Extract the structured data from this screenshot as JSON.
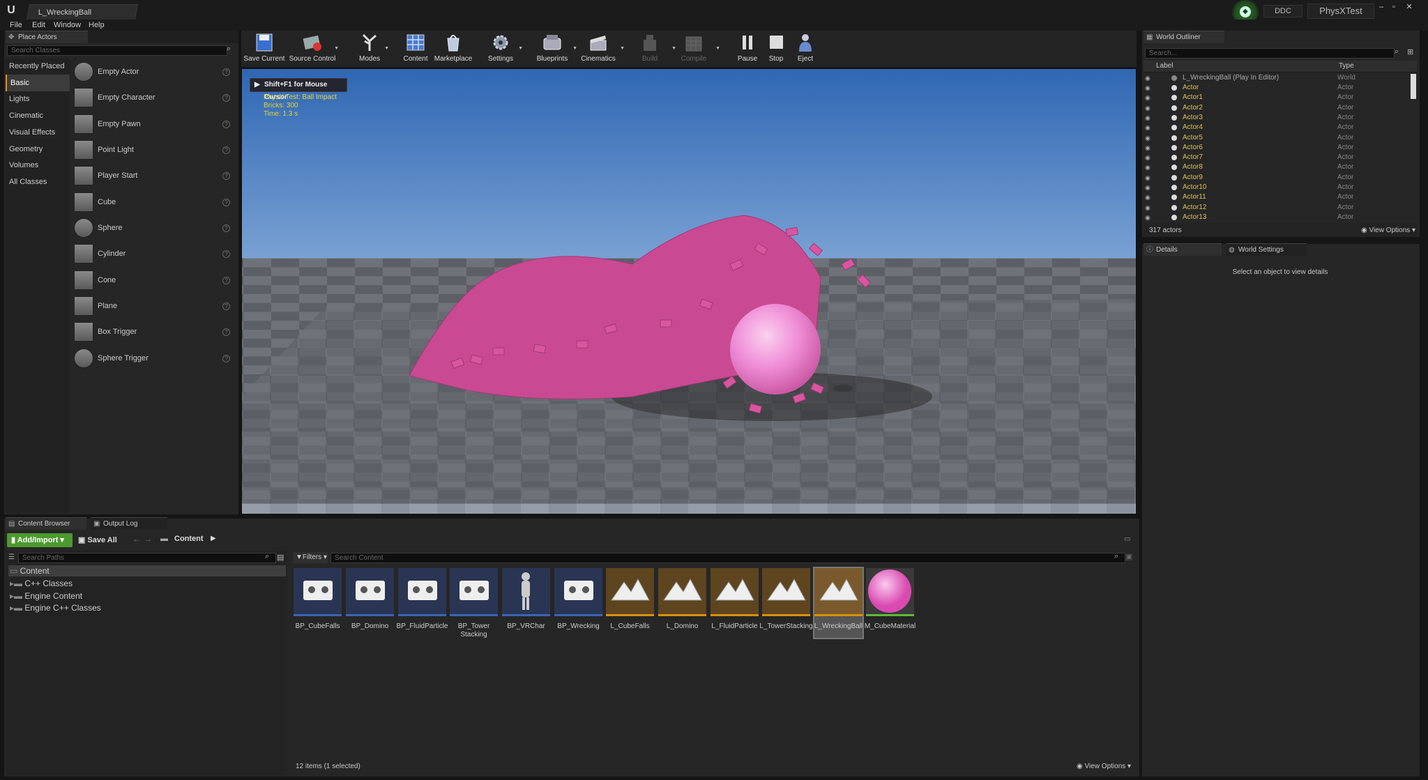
{
  "window": {
    "tab_title": "L_WreckingBall",
    "project": "PhysXTest",
    "ddc": "DDC"
  },
  "menu": [
    "File",
    "Edit",
    "Window",
    "Help"
  ],
  "place_actors": {
    "tab": "Place Actors",
    "search_placeholder": "Search Classes",
    "categories": [
      "Recently Placed",
      "Basic",
      "Lights",
      "Cinematic",
      "Visual Effects",
      "Geometry",
      "Volumes",
      "All Classes"
    ],
    "active_category": "Basic",
    "actors": [
      "Empty Actor",
      "Empty Character",
      "Empty Pawn",
      "Point Light",
      "Player Start",
      "Cube",
      "Sphere",
      "Cylinder",
      "Cone",
      "Plane",
      "Box Trigger",
      "Sphere Trigger"
    ]
  },
  "toolbar": {
    "buttons": [
      "Save Current",
      "Source Control",
      "Modes",
      "Content",
      "Marketplace",
      "Settings",
      "Blueprints",
      "Cinematics",
      "Build",
      "Compile",
      "Pause",
      "Stop",
      "Eject"
    ]
  },
  "viewport": {
    "mouse_hint": "Shift+F1 for Mouse Cursor",
    "overlay_lines": [
      "PhysX Test: Ball Impact",
      "Bricks: 300",
      "Time: 1.3 s"
    ]
  },
  "outliner": {
    "tab": "World Outliner",
    "search_placeholder": "Search...",
    "col_label": "Label",
    "col_type": "Type",
    "root": {
      "label": "L_WreckingBall (Play In Editor)",
      "type": "World"
    },
    "rows": [
      {
        "label": "Actor",
        "type": "Actor"
      },
      {
        "label": "Actor1",
        "type": "Actor"
      },
      {
        "label": "Actor2",
        "type": "Actor"
      },
      {
        "label": "Actor3",
        "type": "Actor"
      },
      {
        "label": "Actor4",
        "type": "Actor"
      },
      {
        "label": "Actor5",
        "type": "Actor"
      },
      {
        "label": "Actor6",
        "type": "Actor"
      },
      {
        "label": "Actor7",
        "type": "Actor"
      },
      {
        "label": "Actor8",
        "type": "Actor"
      },
      {
        "label": "Actor9",
        "type": "Actor"
      },
      {
        "label": "Actor10",
        "type": "Actor"
      },
      {
        "label": "Actor11",
        "type": "Actor"
      },
      {
        "label": "Actor12",
        "type": "Actor"
      },
      {
        "label": "Actor13",
        "type": "Actor"
      }
    ],
    "count": "317 actors",
    "view_options": "View Options"
  },
  "details": {
    "tab": "Details",
    "tab2": "World Settings",
    "empty_msg": "Select an object to view details"
  },
  "content_browser": {
    "tab": "Content Browser",
    "tab2": "Output Log",
    "add_import": "Add/Import",
    "save_all": "Save All",
    "path": "Content",
    "search_paths_placeholder": "Search Paths",
    "filters": "Filters",
    "search_content_placeholder": "Search Content",
    "tree": [
      "Content",
      "C++ Classes",
      "Engine Content",
      "Engine C++ Classes"
    ],
    "assets": [
      {
        "name": "BP_CubeFalls",
        "kind": "blueprint"
      },
      {
        "name": "BP_Domino",
        "kind": "blueprint"
      },
      {
        "name": "BP_FluidParticle",
        "kind": "blueprint"
      },
      {
        "name": "BP_Tower Stacking",
        "kind": "blueprint"
      },
      {
        "name": "BP_VRChar",
        "kind": "character"
      },
      {
        "name": "BP_Wrecking",
        "kind": "blueprint"
      },
      {
        "name": "L_CubeFalls",
        "kind": "level"
      },
      {
        "name": "L_Domino",
        "kind": "level"
      },
      {
        "name": "L_FluidParticle",
        "kind": "level"
      },
      {
        "name": "L_TowerStacking",
        "kind": "level"
      },
      {
        "name": "L_WreckingBall",
        "kind": "level",
        "selected": true
      },
      {
        "name": "M_CubeMaterial",
        "kind": "material"
      }
    ],
    "status": "12 items (1 selected)",
    "view_options": "View Options"
  },
  "colors": {
    "accent": "#e08f1a",
    "brick": "#d9569f",
    "blueprint": "#3c64b4",
    "level": "#d7900f",
    "material": "#5db93b"
  }
}
